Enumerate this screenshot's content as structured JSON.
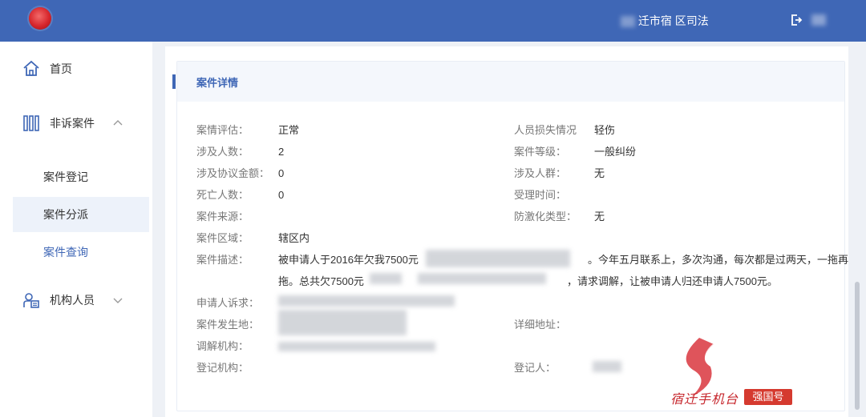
{
  "header": {
    "user_text": "迁市宿 区司法",
    "colors": {
      "bar": "#3f67b6",
      "logo": "#d7262c"
    }
  },
  "sidebar": {
    "home": "首页",
    "non_litigation": "非诉案件",
    "sub_items": [
      "案件登记",
      "案件分派",
      "案件查询"
    ],
    "org_staff": "机构人员"
  },
  "case": {
    "section_title": "案件详情",
    "left_fields": [
      {
        "label": "案情评估：",
        "value": "正常"
      },
      {
        "label": "涉及人数：",
        "value": "2"
      },
      {
        "label": "涉及协议金额：",
        "value": "0"
      },
      {
        "label": "死亡人数：",
        "value": "0"
      },
      {
        "label": "案件来源：",
        "value": ""
      },
      {
        "label": "案件区域：",
        "value": "辖区内"
      }
    ],
    "right_fields": [
      {
        "label": "人员损失情况",
        "value": "轻伤"
      },
      {
        "label": "案件等级：",
        "value": "一般纠纷"
      },
      {
        "label": "涉及人群：",
        "value": "无"
      },
      {
        "label": "受理时间：",
        "value": ""
      },
      {
        "label": "防激化类型：",
        "value": "无"
      }
    ],
    "description": {
      "label": "案件描述：",
      "line1_a": "被申请人于2016年欠我7500元",
      "line1_b": "。今年五月联系上，多次沟通，每次都是过两天，一拖再",
      "line2_a": "拖。总共欠7500元",
      "line2_b": "，请求调解，让被申请人归还申请人7500元。"
    },
    "applicant_claim_label": "申请人诉求：",
    "location_label": "案件发生地：",
    "mediation_org_label": "调解机构：",
    "register_org_label": "登记机构：",
    "address_label": "详细地址：",
    "registrar_label": "登记人："
  },
  "watermark": {
    "text": "宿迁手机台",
    "badge": "强国号"
  }
}
